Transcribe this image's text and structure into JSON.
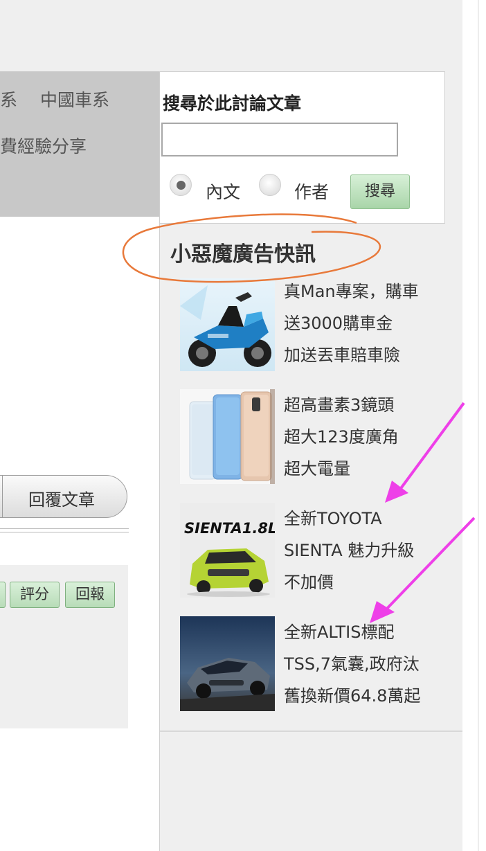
{
  "nav": {
    "line1_a": "系",
    "line1_b": "中國車系",
    "line2": "費經驗分享"
  },
  "actions": {
    "reply_label": "回覆文章",
    "rate_label": "評分",
    "report_label": "回報"
  },
  "search": {
    "title": "搜尋於此討論文章",
    "input_value": "",
    "option_content": "內文",
    "option_author": "作者",
    "selected_option": "內文",
    "button_label": "搜尋"
  },
  "ads": {
    "title": "小惡魔廣告快訊",
    "items": [
      {
        "lines": [
          "真Man專案，購車",
          "送3000購車金",
          "加送丟車賠車險"
        ],
        "image": "blue-scooter"
      },
      {
        "lines": [
          "超高畫素3鏡頭",
          "超大123度廣角",
          "超大電量"
        ],
        "image": "smartphones"
      },
      {
        "lines": [
          "全新TOYOTA",
          "SIENTA 魅力升級",
          "不加價"
        ],
        "image": "sienta-car",
        "image_text": "SIENTA1.8L"
      },
      {
        "lines": [
          "全新ALTIS標配",
          "TSS,7氣囊,政府汰",
          "舊換新價64.8萬起"
        ],
        "image": "altis-car"
      }
    ]
  },
  "colors": {
    "annotation_orange": "#e8793a",
    "annotation_arrow": "#ee3fe8",
    "button_green": "#b8dcb8"
  }
}
